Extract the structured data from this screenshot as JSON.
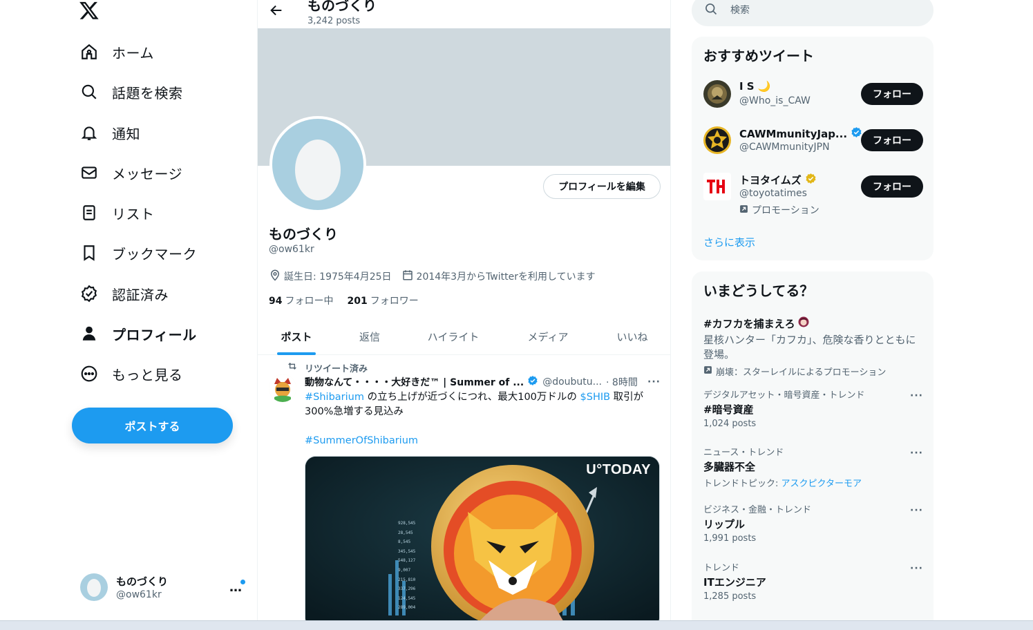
{
  "nav": {
    "items": [
      {
        "label": "ホーム",
        "icon": "home-icon"
      },
      {
        "label": "話題を検索",
        "icon": "search-icon"
      },
      {
        "label": "通知",
        "icon": "bell-icon"
      },
      {
        "label": "メッセージ",
        "icon": "mail-icon"
      },
      {
        "label": "リスト",
        "icon": "list-icon"
      },
      {
        "label": "ブックマーク",
        "icon": "bookmark-icon"
      },
      {
        "label": "認証済み",
        "icon": "verified-icon"
      },
      {
        "label": "プロフィール",
        "icon": "person-icon"
      },
      {
        "label": "もっと見る",
        "icon": "more-circle-icon"
      }
    ],
    "post_button": "ポストする",
    "account": {
      "name": "ものづくり",
      "handle": "@ow61kr",
      "more": "…"
    }
  },
  "header": {
    "title": "ものづくり",
    "posts": "3,242 posts"
  },
  "profile": {
    "name": "ものづくり",
    "handle": "@ow61kr",
    "edit_button": "プロフィールを編集",
    "birthday": "誕生日: 1975年4月25日",
    "joined": "2014年3月からTwitterを利用しています",
    "following_count": "94",
    "following_label": "フォロー中",
    "followers_count": "201",
    "followers_label": "フォロワー"
  },
  "tabs": [
    "ポスト",
    "返信",
    "ハイライト",
    "メディア",
    "いいね"
  ],
  "tweet": {
    "retweet_label": "リツイート済み",
    "name": "動物なんて・・・・大好きだ™ | Summer of ...",
    "handle": "@doubutu...",
    "time": "· 8時間",
    "tag1": "#Shibarium",
    "text1": " の立ち上げが近づくにつれ、最大100万ドルの ",
    "tag2": "$SHIB",
    "text2": " 取引が300%急増する見込み",
    "tag3": "#SummerOfShibarium",
    "image_brand": "U°TODAY",
    "image_numbers": [
      "928,545",
      "28,545",
      "8,545",
      "345,545",
      "548,127",
      "9,007",
      "215,810",
      "337,296",
      "124,545",
      "289,004"
    ]
  },
  "search": {
    "placeholder": "検索"
  },
  "recommend": {
    "title": "おすすめツイート",
    "users": [
      {
        "name": "I S 🌙",
        "handle": "@Who_is_CAW",
        "button": "フォロー"
      },
      {
        "name": "CAWMmunityJap...",
        "handle": "@CAWMmunityJPN",
        "button": "フォロー",
        "verified": "blue"
      },
      {
        "name": "トヨタイムズ",
        "handle": "@toyotatimes",
        "button": "フォロー",
        "verified": "gold",
        "promo": "プロモーション"
      }
    ],
    "show_more": "さらに表示"
  },
  "trends": {
    "title": "いまどうしてる？",
    "promo": {
      "tag": "#カフカを捕まえろ",
      "desc": "星核ハンター「カフカ」、危険な香りとともに登場。",
      "promo_line": "崩壊：スターレイルによるプロモーション"
    },
    "items": [
      {
        "meta": "デジタルアセット・暗号資産・トレンド",
        "title": "#暗号資産",
        "sub": "1,024 posts"
      },
      {
        "meta": "ニュース・トレンド",
        "title": "多臓器不全",
        "sub_prefix": "トレンドトピック: ",
        "sub_link": "アスクピクターモア"
      },
      {
        "meta": "ビジネス・金融・トレンド",
        "title": "リップル",
        "sub": "1,991 posts"
      },
      {
        "meta": "トレンド",
        "title": "ITエンジニア",
        "sub": "1,285 posts"
      }
    ]
  },
  "colors": {
    "accent": "#1d9bf0",
    "text": "#0f1419",
    "muted": "#536471",
    "banner": "#cfd9de",
    "avatar": "#a9cfe0"
  }
}
